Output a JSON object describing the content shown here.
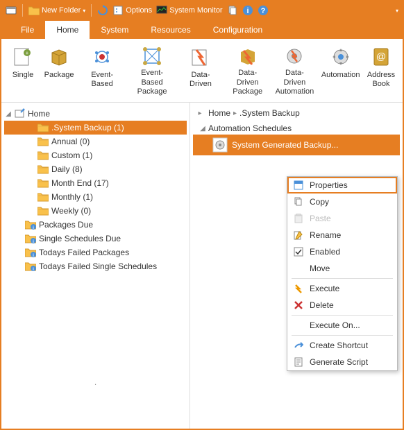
{
  "qat": {
    "new_folder": "New Folder",
    "options": "Options",
    "system_monitor": "System Monitor"
  },
  "menu": {
    "file": "File",
    "home": "Home",
    "system": "System",
    "resources": "Resources",
    "configuration": "Configuration"
  },
  "ribbon": {
    "single": "Single",
    "package": "Package",
    "event_based": "Event-Based",
    "event_based_package": "Event-Based\nPackage",
    "data_driven": "Data-Driven",
    "data_driven_package": "Data-Driven\nPackage",
    "data_driven_automation": "Data-Driven\nAutomation",
    "automation": "Automation",
    "address_book": "Address\nBook"
  },
  "left_tree": {
    "root": "Home",
    "items": [
      {
        "label": ".System Backup (1)",
        "selected": true,
        "indent": 2
      },
      {
        "label": "Annual (0)",
        "indent": 2
      },
      {
        "label": "Custom (1)",
        "indent": 2
      },
      {
        "label": "Daily (8)",
        "indent": 2
      },
      {
        "label": "Month End  (17)",
        "indent": 2
      },
      {
        "label": "Monthly (1)",
        "indent": 2
      },
      {
        "label": "Weekly (0)",
        "indent": 2
      },
      {
        "label": "Packages Due",
        "indent": 1,
        "info": true
      },
      {
        "label": "Single Schedules Due",
        "indent": 1,
        "info": true
      },
      {
        "label": "Todays Failed Packages",
        "indent": 1,
        "info": true
      },
      {
        "label": "Todays Failed Single Schedules",
        "indent": 1,
        "info": true
      }
    ]
  },
  "breadcrumbs": {
    "home": "Home",
    "current": ".System Backup"
  },
  "right_tree": {
    "group": "Automation Schedules",
    "item": "System Generated Backup..."
  },
  "context_menu": {
    "properties": "Properties",
    "copy": "Copy",
    "paste": "Paste",
    "rename": "Rename",
    "enabled": "Enabled",
    "move": "Move",
    "execute": "Execute",
    "delete": "Delete",
    "execute_on": "Execute On...",
    "create_shortcut": "Create Shortcut",
    "generate_script": "Generate Script"
  },
  "colors": {
    "accent": "#e67e22"
  }
}
